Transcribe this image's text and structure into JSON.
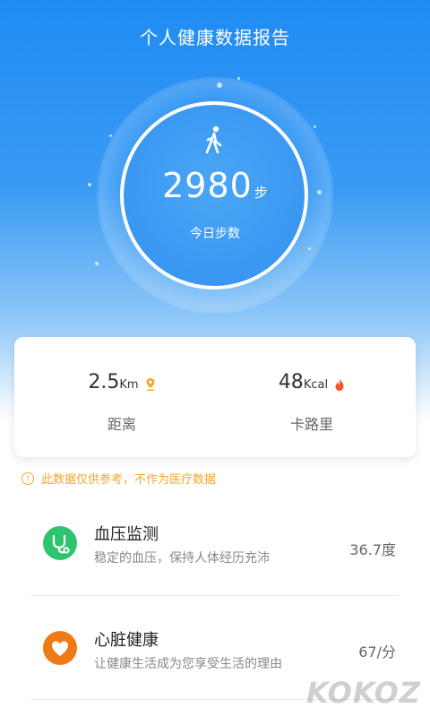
{
  "header": {
    "title": "个人健康数据报告"
  },
  "steps": {
    "value": "2980",
    "unit": "步",
    "label": "今日步数"
  },
  "summary": {
    "distance": {
      "value": "2.5",
      "unit": "Km",
      "label": "距离"
    },
    "calories": {
      "value": "48",
      "unit": "Kcal",
      "label": "卡路里"
    }
  },
  "notice": {
    "text": "此数据仅供参考，不作为医疗数据"
  },
  "items": [
    {
      "name": "血压监测",
      "desc": "稳定的血压，保持人体经历充沛",
      "value": "36.7度",
      "icon": "stethoscope-icon",
      "color": "#2ec46f"
    },
    {
      "name": "心脏健康",
      "desc": "让健康生活成为您享受生活的理由",
      "value": "67/分",
      "icon": "heart-icon",
      "color": "#f07a16"
    }
  ],
  "watermark": "KOKOZ"
}
